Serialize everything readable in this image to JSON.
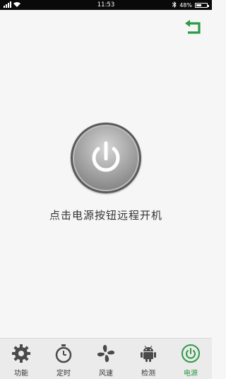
{
  "status_bar": {
    "time": "11:53",
    "battery": "48%",
    "battery_level": 0.48
  },
  "main": {
    "hint": "点击电源按钮远程开机"
  },
  "nav": {
    "items": [
      {
        "label": "功能",
        "icon": "gear-icon"
      },
      {
        "label": "定时",
        "icon": "stopwatch-icon"
      },
      {
        "label": "风速",
        "icon": "fan-icon"
      },
      {
        "label": "检测",
        "icon": "android-icon"
      },
      {
        "label": "电源",
        "icon": "power-icon",
        "active": true
      }
    ]
  },
  "colors": {
    "accent": "#2e9a45",
    "status_bar_bg": "#0a0a0a",
    "background": "#f6f6f6"
  }
}
